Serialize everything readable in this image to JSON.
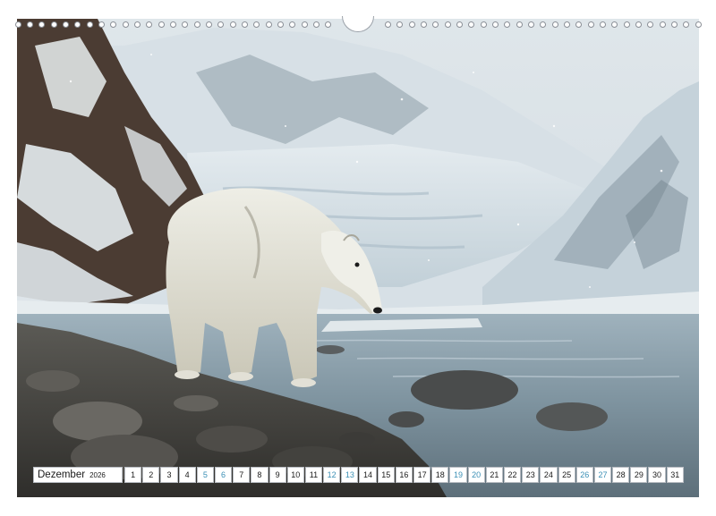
{
  "calendar": {
    "month": "Dezember",
    "year": "2026",
    "days": [
      {
        "label": "1",
        "weekend": false
      },
      {
        "label": "2",
        "weekend": false
      },
      {
        "label": "3",
        "weekend": false
      },
      {
        "label": "4",
        "weekend": false
      },
      {
        "label": "5",
        "weekend": true
      },
      {
        "label": "6",
        "weekend": true
      },
      {
        "label": "7",
        "weekend": false
      },
      {
        "label": "8",
        "weekend": false
      },
      {
        "label": "9",
        "weekend": false
      },
      {
        "label": "10",
        "weekend": false
      },
      {
        "label": "11",
        "weekend": false
      },
      {
        "label": "12",
        "weekend": true
      },
      {
        "label": "13",
        "weekend": true
      },
      {
        "label": "14",
        "weekend": false
      },
      {
        "label": "15",
        "weekend": false
      },
      {
        "label": "16",
        "weekend": false
      },
      {
        "label": "17",
        "weekend": false
      },
      {
        "label": "18",
        "weekend": false
      },
      {
        "label": "19",
        "weekend": true
      },
      {
        "label": "20",
        "weekend": true
      },
      {
        "label": "21",
        "weekend": false
      },
      {
        "label": "22",
        "weekend": false
      },
      {
        "label": "23",
        "weekend": false
      },
      {
        "label": "24",
        "weekend": false
      },
      {
        "label": "25",
        "weekend": false
      },
      {
        "label": "26",
        "weekend": true
      },
      {
        "label": "27",
        "weekend": true
      },
      {
        "label": "28",
        "weekend": false
      },
      {
        "label": "29",
        "weekend": false
      },
      {
        "label": "30",
        "weekend": false
      },
      {
        "label": "31",
        "weekend": false
      }
    ]
  },
  "colors": {
    "weekday_text": "#1a1a1a",
    "weekend_text": "#3a8fb5",
    "cell_border": "#b8bcc2"
  },
  "icons": {
    "binding": "spiral-binding-icon",
    "hanger": "hanger-hook-icon"
  }
}
